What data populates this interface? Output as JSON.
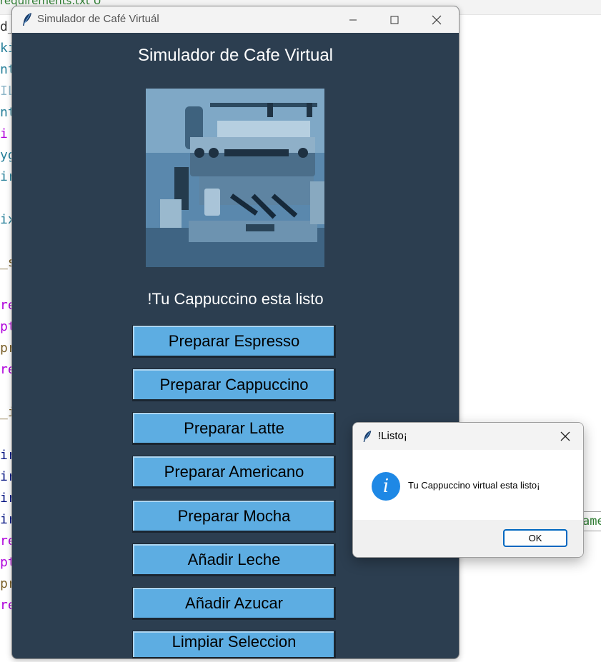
{
  "editor": {
    "tab_label": "requirements.txt",
    "tab_badge": "U",
    "code_fragments": [
      {
        "text": "d_",
        "color": "#333333"
      },
      {
        "text": "ki",
        "color": "#267f99"
      },
      {
        "text": "nt",
        "color": "#267f99"
      },
      {
        "text": "IL",
        "color": "#8fb7c9"
      },
      {
        "text": "nt",
        "color": "#267f99"
      },
      {
        "text": " i",
        "color": "#af00db"
      },
      {
        "text": "yg",
        "color": "#267f99"
      },
      {
        "text": "ir",
        "color": "#267f99"
      },
      {
        "text": "",
        "color": "#333333"
      },
      {
        "text": "ix",
        "color": "#267f99"
      },
      {
        "text": "",
        "color": "#333333"
      },
      {
        "text": "_s",
        "color": "#795e26"
      },
      {
        "text": "",
        "color": "#333333"
      },
      {
        "text": "re",
        "color": "#af00db"
      },
      {
        "text": "pt",
        "color": "#af00db"
      },
      {
        "text": "pr",
        "color": "#795e26"
      },
      {
        "text": "re",
        "color": "#af00db"
      },
      {
        "text": "",
        "color": "#333333"
      },
      {
        "text": "_i",
        "color": "#795e26"
      },
      {
        "text": "",
        "color": "#333333"
      },
      {
        "text": "ir",
        "color": "#001080"
      },
      {
        "text": "ir",
        "color": "#001080"
      },
      {
        "text": "ir",
        "color": "#001080"
      },
      {
        "text": "ir",
        "color": "#001080"
      },
      {
        "text": "re",
        "color": "#af00db"
      },
      {
        "text": "pt",
        "color": "#af00db"
      },
      {
        "text": "pr",
        "color": "#795e26"
      },
      {
        "text": "re",
        "color": "#af00db"
      }
    ],
    "side_input_text": "ame"
  },
  "window": {
    "title": "Simulador de Café Virtuál",
    "minimize_icon": "minimize-icon",
    "maximize_icon": "maximize-icon",
    "close_icon": "close-icon"
  },
  "app": {
    "heading": "Simulador de Cafe Virtual",
    "status": "!Tu Cappuccino esta listo",
    "buttons": [
      "Preparar Espresso",
      "Preparar Cappuccino",
      "Preparar Latte",
      "Preparar Americano",
      "Preparar Mocha",
      "Añadir Leche",
      "Añadir Azucar",
      "Limpiar Seleccion"
    ]
  },
  "dialog": {
    "title": "!Listo¡",
    "message": "Tu Cappuccino virtual esta listo¡",
    "ok_label": "OK",
    "icon": "info-icon"
  },
  "colors": {
    "window_bg": "#2c3e50",
    "button_bg": "#5dade2",
    "info_blue": "#1e88e5",
    "ok_border": "#0067c0"
  }
}
